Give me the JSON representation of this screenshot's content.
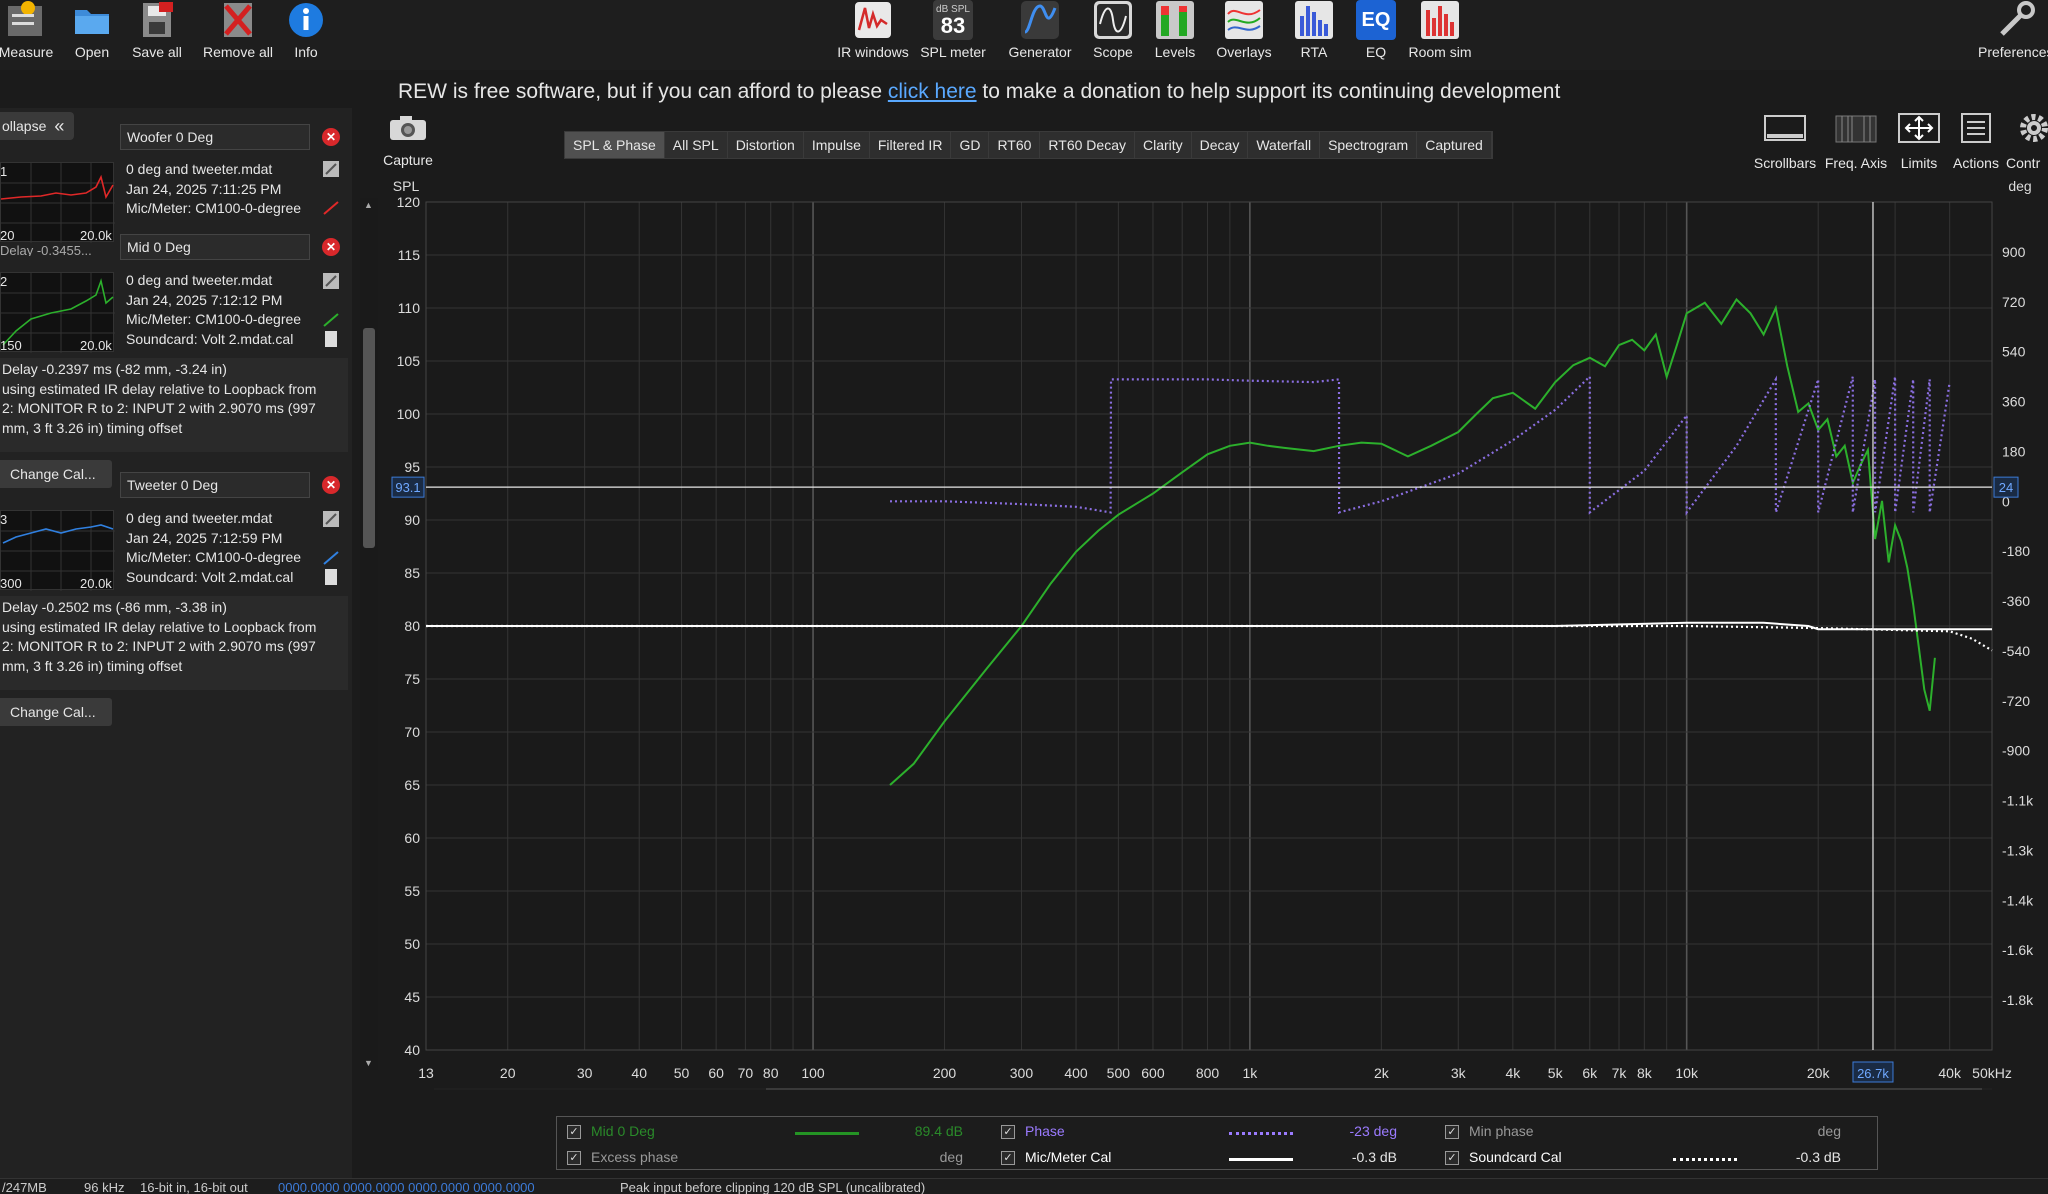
{
  "toolbar": {
    "left": [
      {
        "label": "Measure",
        "icon": "measure-icon"
      },
      {
        "label": "Open",
        "icon": "folder-icon"
      },
      {
        "label": "Save all",
        "icon": "save-icon"
      },
      {
        "label": "Remove all",
        "icon": "remove-icon"
      },
      {
        "label": "Info",
        "icon": "info-icon"
      }
    ],
    "center": [
      {
        "label": "IR windows",
        "icon": "ir-windows-icon"
      },
      {
        "label": "SPL meter",
        "icon": "spl-meter-icon",
        "badge_top": "dB SPL",
        "badge_value": "83"
      },
      {
        "label": "Generator",
        "icon": "generator-icon"
      },
      {
        "label": "Scope",
        "icon": "scope-icon"
      },
      {
        "label": "Levels",
        "icon": "levels-icon"
      },
      {
        "label": "Overlays",
        "icon": "overlays-icon"
      },
      {
        "label": "RTA",
        "icon": "rta-icon"
      },
      {
        "label": "EQ",
        "icon": "eq-icon",
        "badge_value": "EQ"
      },
      {
        "label": "Room sim",
        "icon": "room-sim-icon"
      }
    ],
    "right": {
      "label": "Preferences",
      "icon": "wrench-icon"
    }
  },
  "donation": {
    "before": "REW is free software, but if you can afford to please ",
    "link": "click here",
    "after": " to make a donation to help support its continuing development"
  },
  "left_panel": {
    "collapse_label": "ollapse",
    "collapse_icon": "double-chevron-left-icon",
    "measurements": [
      {
        "title": "Woofer 0 Deg",
        "num": "1",
        "thumb_left": "20",
        "thumb_right": "20.0k",
        "color": "#e02828",
        "lines": [
          "0 deg and tweeter.mdat",
          "Jan 24, 2025 7:11:25 PM",
          "Mic/Meter: CM100-0-degree"
        ],
        "hidden_line": "Delay -0.3455..."
      },
      {
        "title": "Mid 0 Deg",
        "num": "2",
        "thumb_left": "150",
        "thumb_right": "20.0k",
        "color": "#2cb02c",
        "lines": [
          "0 deg and tweeter.mdat",
          "Jan 24, 2025 7:12:12 PM",
          "Mic/Meter: CM100-0-degree",
          "Soundcard: Volt 2.mdat.cal"
        ],
        "delay": [
          "Delay -0.2397 ms (-82 mm, -3.24 in)",
          "using estimated IR delay relative to Loopback from",
          "2: MONITOR R to 2: INPUT 2 with 2.9070 ms (997",
          "mm, 3 ft 3.26 in) timing offset"
        ],
        "change_cal": "Change Cal..."
      },
      {
        "title": "Tweeter 0 Deg",
        "num": "3",
        "thumb_left": "300",
        "thumb_right": "20.0k",
        "color": "#3080e0",
        "lines": [
          "0 deg and tweeter.mdat",
          "Jan 24, 2025 7:12:59 PM",
          "Mic/Meter: CM100-0-degree",
          "Soundcard: Volt 2.mdat.cal"
        ],
        "delay": [
          "Delay -0.2502 ms (-86 mm, -3.38 in)",
          "using estimated IR delay relative to Loopback from",
          "2: MONITOR R to 2: INPUT 2 with 2.9070 ms (997",
          "mm, 3 ft 3.26 in) timing offset"
        ],
        "change_cal": "Change Cal..."
      }
    ]
  },
  "graph_toolbar": {
    "capture_label": "Capture",
    "tabs": [
      "SPL & Phase",
      "All SPL",
      "Distortion",
      "Impulse",
      "Filtered IR",
      "GD",
      "RT60",
      "RT60 Decay",
      "Clarity",
      "Decay",
      "Waterfall",
      "Spectrogram",
      "Captured"
    ],
    "active_tab": "SPL & Phase",
    "right_buttons": [
      {
        "label": "Scrollbars",
        "icon": "scrollbars-icon"
      },
      {
        "label": "Freq. Axis",
        "icon": "freq-axis-icon"
      },
      {
        "label": "Limits",
        "icon": "limits-icon"
      },
      {
        "label": "Actions",
        "icon": "actions-icon"
      },
      {
        "label": "Contr",
        "icon": "gear-icon"
      }
    ]
  },
  "chart_data": {
    "type": "line",
    "xscale": "log",
    "xlim": [
      13,
      50000
    ],
    "ylim": [
      40,
      120
    ],
    "y2lim": [
      -1980,
      1080
    ],
    "ylabel": "SPL",
    "y2label": "deg",
    "x_ticks": [
      "13",
      "20",
      "30",
      "40",
      "50",
      "60",
      "70",
      "80",
      "100",
      "200",
      "300",
      "400",
      "500",
      "600",
      "800",
      "1k",
      "2k",
      "3k",
      "4k",
      "5k",
      "6k",
      "7k",
      "8k",
      "10k",
      "20k",
      "26.7k",
      "k",
      "40k",
      "50kHz"
    ],
    "x_tick_values": [
      13,
      20,
      30,
      40,
      50,
      60,
      70,
      80,
      100,
      200,
      300,
      400,
      500,
      600,
      800,
      1000,
      2000,
      3000,
      4000,
      5000,
      6000,
      7000,
      8000,
      10000,
      20000,
      26700,
      29000,
      40000,
      50000
    ],
    "y_ticks": [
      120,
      115,
      110,
      105,
      100,
      95,
      90,
      85,
      80,
      75,
      70,
      65,
      60,
      55,
      50,
      45,
      40
    ],
    "y2_ticks": [
      "900",
      "720",
      "540",
      "360",
      "180",
      "0",
      "-180",
      "-360",
      "-540",
      "-720",
      "-900",
      "-1.1k",
      "-1.3k",
      "-1.4k",
      "-1.6k",
      "-1.8k"
    ],
    "y2_tick_values": [
      900,
      720,
      540,
      360,
      180,
      0,
      -180,
      -360,
      -540,
      -720,
      -900,
      -1080,
      -1260,
      -1440,
      -1620,
      -1800
    ],
    "cursor": {
      "x": 26700,
      "x_label": "26.7k",
      "y": 93.1,
      "y_label": "93.1",
      "y2_label": "24"
    },
    "series": [
      {
        "name": "Mid 0 Deg",
        "color": "#2cb02c",
        "style": "solid",
        "x": [
          150,
          170,
          200,
          250,
          300,
          350,
          400,
          450,
          500,
          600,
          700,
          800,
          900,
          1000,
          1100,
          1200,
          1400,
          1600,
          1800,
          2000,
          2300,
          2600,
          3000,
          3300,
          3600,
          4000,
          4500,
          5000,
          5500,
          6000,
          6500,
          7000,
          7500,
          8000,
          8500,
          9000,
          9500,
          10000,
          11000,
          12000,
          13000,
          14000,
          15000,
          16000,
          17000,
          18000,
          19000,
          20000,
          21000,
          22000,
          23000,
          24000,
          25000,
          26000,
          27000,
          28000,
          29000,
          30000,
          31000,
          32000,
          33000,
          34000,
          35000,
          36000,
          37000
        ],
        "y": [
          65,
          67,
          71,
          76,
          80,
          84,
          87,
          89,
          90.5,
          92.5,
          94.5,
          96.2,
          97,
          97.3,
          97,
          96.8,
          96.5,
          97,
          97.3,
          97.2,
          96,
          97,
          98.3,
          100,
          101.5,
          102,
          100.5,
          103,
          104.6,
          105.3,
          104.5,
          106.5,
          107,
          106,
          107.5,
          103.5,
          106.5,
          109.5,
          110.5,
          108.5,
          110.8,
          109.5,
          107.5,
          110,
          104.5,
          100.2,
          101,
          98.5,
          99.5,
          96,
          97,
          93.5,
          95.2,
          96.6,
          88.2,
          91.8,
          86,
          89.5,
          88,
          85.5,
          82,
          78,
          74,
          72,
          77
        ]
      },
      {
        "name": "Phase",
        "color": "#8a6ee0",
        "style": "dotted",
        "x": [
          150,
          200,
          300,
          400,
          480,
          481,
          600,
          800,
          1000,
          1400,
          1600,
          1601,
          2000,
          3000,
          4000,
          5000,
          6000,
          6001,
          8000,
          10000,
          10001,
          13000,
          16000,
          16001,
          20000,
          20001,
          24000,
          24001,
          27000,
          27001,
          30000,
          30001,
          33000,
          33001,
          36000,
          36001,
          40000
        ],
        "y": [
          0,
          0,
          -10,
          -20,
          -40,
          440,
          440,
          440,
          435,
          430,
          440,
          -40,
          0,
          100,
          220,
          330,
          450,
          -40,
          110,
          310,
          -40,
          200,
          440,
          -40,
          440,
          -40,
          450,
          -40,
          440,
          -40,
          450,
          -40,
          440,
          -40,
          440,
          -40,
          430
        ]
      },
      {
        "name": "Mic/Meter Cal",
        "color": "#ffffff",
        "style": "solid",
        "x": [
          13,
          1000,
          5000,
          10000,
          15000,
          19000,
          20000,
          50000
        ],
        "y": [
          80,
          80,
          80,
          80.3,
          80.3,
          80,
          79.7,
          79.7
        ]
      },
      {
        "name": "Soundcard Cal",
        "color": "#ffffff",
        "style": "dotted",
        "x": [
          13,
          10000,
          20000,
          40000,
          45000,
          50000
        ],
        "y": [
          80,
          80,
          79.8,
          79.5,
          78.8,
          77.7
        ]
      }
    ]
  },
  "legend": {
    "rows": [
      {
        "label": "Mid 0 Deg",
        "checked": true,
        "value": "89.4 dB",
        "color": "#2cb02c",
        "dim": true,
        "line": "solid"
      },
      {
        "label": "Phase",
        "checked": true,
        "value": "-23 deg",
        "color": "#9b7bff",
        "line": "dotted"
      },
      {
        "label": "Min phase",
        "checked": true,
        "value": "deg",
        "color": "#bdbdbd",
        "dim": true,
        "line": "none"
      },
      {
        "label": "Excess phase",
        "checked": true,
        "value": "deg",
        "color": "#bdbdbd",
        "dim": true,
        "line": "none"
      },
      {
        "label": "Mic/Meter Cal",
        "checked": true,
        "value": "-0.3 dB",
        "color": "#ffffff",
        "line": "solid"
      },
      {
        "label": "Soundcard Cal",
        "checked": true,
        "value": "-0.3 dB",
        "color": "#ffffff",
        "line": "dotted"
      }
    ]
  },
  "status_bar": {
    "memory": "/247MB",
    "rate": "96 kHz",
    "bits": "16-bit in, 16-bit out",
    "levels": "0000.0000  0000.0000  0000.0000  0000.0000",
    "peak": "Peak input before clipping 120 dB SPL (uncalibrated)"
  }
}
